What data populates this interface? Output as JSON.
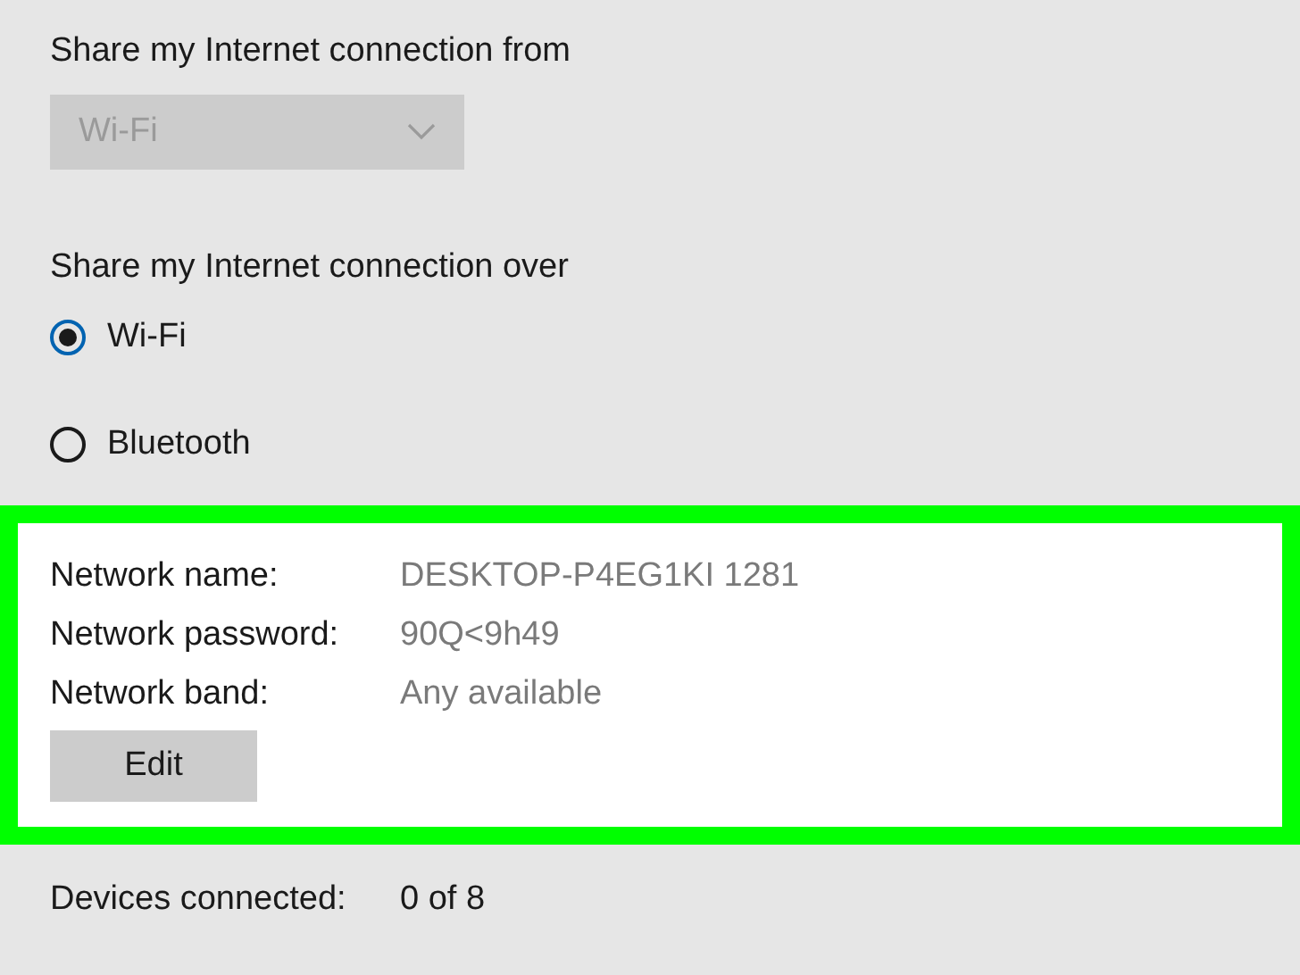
{
  "share_from": {
    "label": "Share my Internet connection from",
    "dropdown": {
      "value": "Wi-Fi",
      "disabled": true
    }
  },
  "share_over": {
    "label": "Share my Internet connection over",
    "options": [
      {
        "label": "Wi-Fi",
        "selected": true
      },
      {
        "label": "Bluetooth",
        "selected": false
      }
    ]
  },
  "network_info": {
    "highlighted": true,
    "rows": [
      {
        "label": "Network name:",
        "value": "DESKTOP-P4EG1KI 1281"
      },
      {
        "label": "Network password:",
        "value": "90Q<9h49"
      },
      {
        "label": "Network band:",
        "value": "Any available"
      }
    ],
    "button": "Edit"
  },
  "devices": {
    "label": "Devices connected:",
    "value": "0 of 8"
  }
}
